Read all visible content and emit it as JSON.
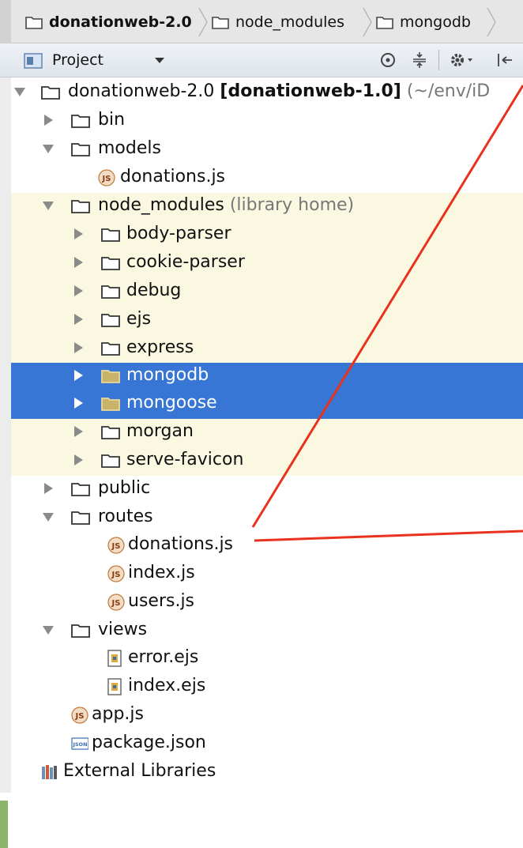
{
  "breadcrumb": {
    "items": [
      "donationweb-2.0",
      "node_modules",
      "mongodb"
    ]
  },
  "toolbar": {
    "view_label": "Project"
  },
  "tree": {
    "root_name": "donationweb-2.0",
    "root_module": "[donationweb-1.0]",
    "root_path": "(~/env/iD",
    "bin": "bin",
    "models": "models",
    "models_file": "donations.js",
    "node_modules": "node_modules",
    "node_modules_note": "(library home)",
    "libs": [
      "body-parser",
      "cookie-parser",
      "debug",
      "ejs",
      "express",
      "mongodb",
      "mongoose",
      "morgan",
      "serve-favicon"
    ],
    "public": "public",
    "routes": "routes",
    "routes_files": [
      "donations.js",
      "index.js",
      "users.js"
    ],
    "views": "views",
    "views_files": [
      "error.ejs",
      "index.ejs"
    ],
    "root_files": [
      "app.js",
      "package.json"
    ],
    "external": "External Libraries"
  },
  "icons": {
    "js_badge": "JS",
    "json_badge": "JSON"
  },
  "colors": {
    "selection": "#3876d6",
    "library_bg": "#fbf8e2",
    "annotation": "#e8321e"
  }
}
